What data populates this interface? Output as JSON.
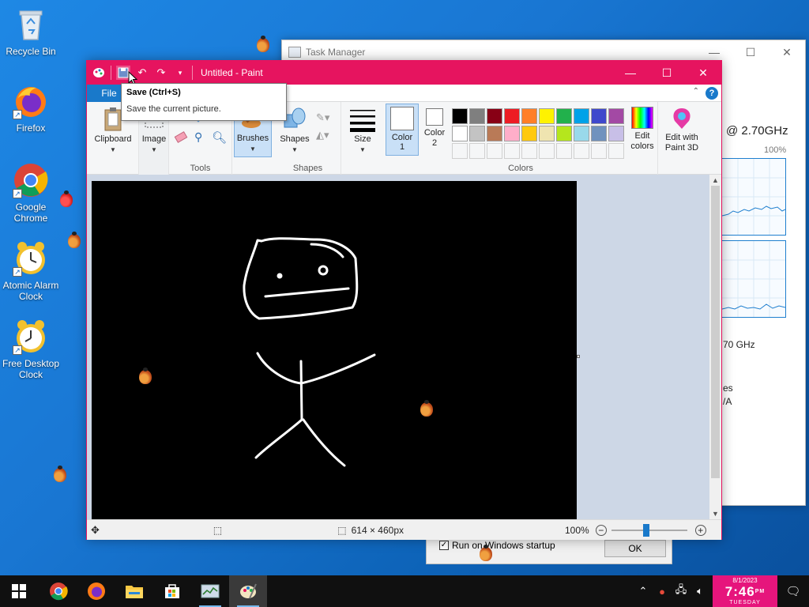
{
  "desktop": {
    "icons": [
      {
        "label": "Recycle Bin"
      },
      {
        "label": "Firefox"
      },
      {
        "label": "Google Chrome"
      },
      {
        "label": "Atomic Alarm Clock"
      },
      {
        "label": "Free Desktop Clock"
      }
    ]
  },
  "task_manager": {
    "title": "Task Manager",
    "cpu_speed": "@ 2.70GHz",
    "percent": "100%",
    "base_speed": "70 GHz",
    "frag1": "es",
    "frag2": "/A"
  },
  "dialog": {
    "checkbox_label": "Run on Windows startup",
    "checked": true,
    "ok_label": "OK"
  },
  "paint": {
    "title": "Untitled - Paint",
    "file_tab": "File",
    "help": "?",
    "ribbon": {
      "clipboard": "Clipboard",
      "image": "Image",
      "tools_group": "Tools",
      "brushes": "Brushes",
      "shapes": "Shapes",
      "shapes_group": "Shapes",
      "size": "Size",
      "color1": "Color 1",
      "color2": "Color 2",
      "colors_group": "Colors",
      "edit_colors": "Edit colors",
      "edit_paint3d": "Edit with Paint 3D"
    },
    "palette_row1": [
      "#000000",
      "#7f7f7f",
      "#880015",
      "#ed1c24",
      "#ff7f27",
      "#fff200",
      "#22b14c",
      "#00a2e8",
      "#3f48cc",
      "#a349a4"
    ],
    "palette_row2": [
      "#ffffff",
      "#c3c3c3",
      "#b97a57",
      "#ffaec9",
      "#ffc90e",
      "#efe4b0",
      "#b5e61d",
      "#99d9ea",
      "#7092be",
      "#c8bfe7"
    ],
    "color1": "#ffffff",
    "color2": "#ffffff",
    "canvas_background": "#000000",
    "accent": "#e6145f",
    "status": {
      "dimensions": "614 × 460px",
      "zoom": "100%"
    }
  },
  "tooltip": {
    "title": "Save (Ctrl+S)",
    "description": "Save the current picture."
  },
  "taskbar": {
    "clock_date": "8/1/2023",
    "clock_time": "7:46",
    "clock_ampm": "PM",
    "clock_day": "TUESDAY"
  }
}
